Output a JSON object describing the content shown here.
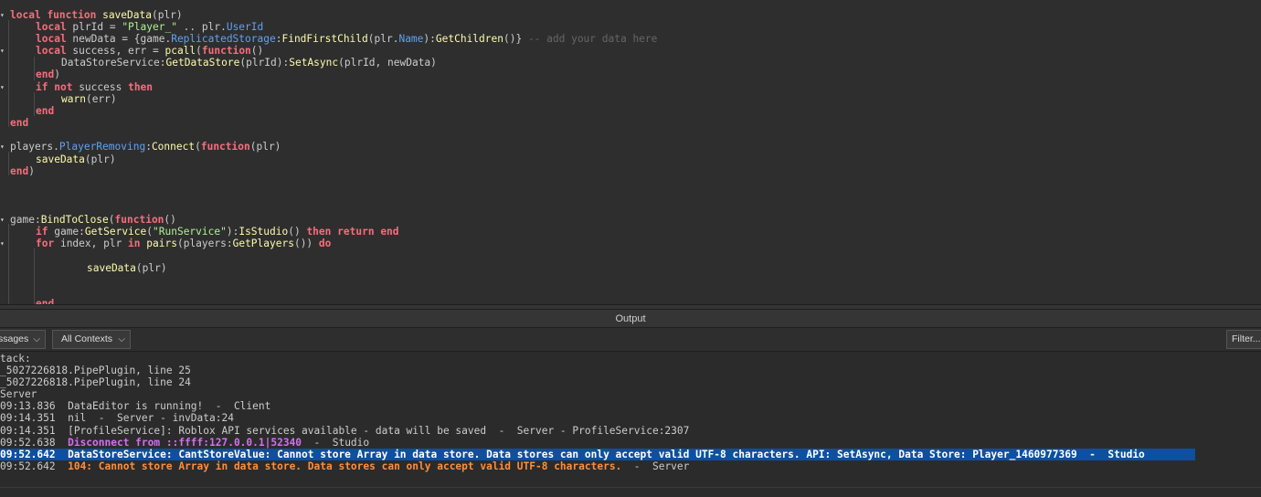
{
  "editor": {
    "lines": {
      "l1": {
        "k1": "local",
        "k2": "function",
        "fn": "saveData",
        "rest": "(plr)"
      },
      "l2": {
        "k1": "local",
        "t1": " plrId = ",
        "s1": "\"Player_\"",
        "t2": " .. plr.",
        "p1": "UserId"
      },
      "l3": {
        "k1": "local",
        "t1": " newData = {game.",
        "p1": "ReplicatedStorage",
        ":": ":",
        "f1": "FindFirstChild",
        "t2": "(plr.",
        "p2": "Name",
        "t3": "):",
        "f2": "GetChildren",
        "t4": "()}",
        "c1": " -- add your data here"
      },
      "l4": {
        "k1": "local",
        "t1": " success, err = ",
        "f1": "pcall",
        "t2": "(",
        "k2": "function",
        "t3": "()"
      },
      "l5": {
        "t1": "DataStoreService:",
        "f1": "GetDataStore",
        "t2": "(plrId):",
        "f2": "SetAsync",
        "t3": "(plrId, newData)"
      },
      "l6": {
        "k1": "end",
        "t1": ")"
      },
      "l7": {
        "k1": "if",
        "k2": "not",
        "t1": " success ",
        "k3": "then"
      },
      "l8": {
        "f1": "warn",
        "t1": "(err)"
      },
      "l9": {
        "k1": "end"
      },
      "l10": {
        "k1": "end"
      },
      "l11": {
        "t1": "players.",
        "p1": "PlayerRemoving",
        ":": ":",
        "f1": "Connect",
        "t2": "(",
        "k1": "function",
        "t3": "(plr)"
      },
      "l12": {
        "f1": "saveData",
        "t1": "(plr)"
      },
      "l13": {
        "k1": "end",
        "t1": ")"
      },
      "l14": {
        "t1": "game:",
        "f1": "BindToClose",
        "t2": "(",
        "k1": "function",
        "t3": "()"
      },
      "l15": {
        "k1": "if",
        "t1": " game:",
        "f1": "GetService",
        "t2": "(",
        "s1": "\"RunService\"",
        "t3": "):",
        "f2": "IsStudio",
        "t4": "() ",
        "k2": "then",
        "k3": "return",
        "k4": "end"
      },
      "l16": {
        "k1": "for",
        "t1": " index, plr ",
        "k2": "in",
        "f1": "pairs",
        "t2": "(players:",
        "f2": "GetPlayers",
        "t3": "()) ",
        "k3": "do"
      },
      "l17": {
        "f1": "saveData",
        "t1": "(plr)"
      },
      "l18": {
        "k1": "end"
      }
    }
  },
  "output": {
    "title": "Output",
    "filter_messages_label": "ssages",
    "filter_contexts_label": "All Contexts",
    "filter_button_label": "Filter...",
    "lines": [
      {
        "text": "tack:"
      },
      {
        "text": "_5027226818.PipePlugin, line 25"
      },
      {
        "text": "_5027226818.PipePlugin, line 24"
      },
      {
        "text": "Server"
      },
      {
        "text": "09:13.836  DataEditor is running!  -  Client"
      },
      {
        "text": "09:14.351  nil  -  Server - invData:24"
      },
      {
        "text": "09:14.351  [ProfileService]: Roblox API services available - data will be saved  -  Server - ProfileService:2307"
      },
      {
        "time": "09:52.638  ",
        "msg": "Disconnect from ::ffff:127.0.0.1|52340",
        "suffix": "  -  Studio"
      },
      {
        "text": "09:52.642  DataStoreService: CantStoreValue: Cannot store Array in data store. Data stores can only accept valid UTF-8 characters. API: SetAsync, Data Store: Player_1460977369  -  Studio"
      },
      {
        "time": "09:52.642  ",
        "msg": "104: Cannot store Array in data store. Data stores can only accept valid UTF-8 characters.",
        "suffix": "  -  Server"
      }
    ]
  },
  "icons": {
    "fold": "▾",
    "chevron": "⌵"
  },
  "colors": {
    "keyword": "#f86d7c",
    "string": "#adf195",
    "property": "#61a1f1",
    "function": "#fdfbac",
    "warning": "#ff8e3c",
    "info": "#d46ff0",
    "selection": "#0e4fa0"
  }
}
